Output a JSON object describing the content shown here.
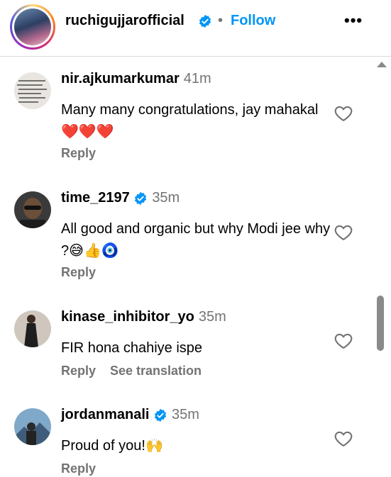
{
  "header": {
    "username": "ruchigujjarofficial",
    "separator": "•",
    "follow_label": "Follow",
    "more_label": "•••"
  },
  "comments": [
    {
      "username": "nir.ajkumarkumar",
      "verified": false,
      "time": "41m",
      "text": "Many many congratulations, jay mahakal ❤️❤️❤️",
      "reply_label": "Reply",
      "avatar_icon": "text-image-avatar"
    },
    {
      "username": "time_2197",
      "verified": true,
      "time": "35m",
      "text": "All good and organic but why Modi jee why ?😅👍🧿",
      "reply_label": "Reply",
      "avatar_icon": "person-sunglasses-avatar"
    },
    {
      "username": "kinase_inhibitor_yo",
      "verified": false,
      "time": "35m",
      "text": "FIR hona chahiye ispe",
      "reply_label": "Reply",
      "translate_label": "See translation",
      "avatar_icon": "person-dress-avatar"
    },
    {
      "username": "jordanmanali",
      "verified": true,
      "time": "35m",
      "text": "Proud of you!🙌",
      "reply_label": "Reply",
      "avatar_icon": "person-mountain-avatar"
    }
  ],
  "colors": {
    "follow": "#0095f6",
    "verified": "#0095f6",
    "muted": "#737373"
  }
}
